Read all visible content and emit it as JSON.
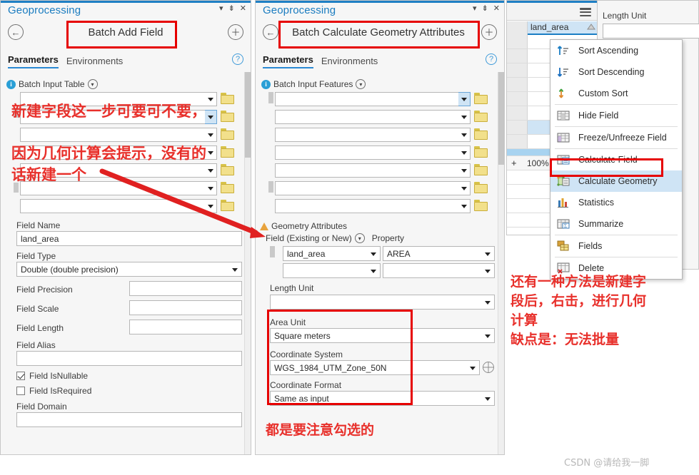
{
  "colors": {
    "accent_blue": "#1f7fc4",
    "title_blue": "#1a7cc0",
    "annotation_red": "#e8302b",
    "highlight_box_red": "#e60000",
    "selection_blue": "#cfe4f5"
  },
  "left_panel": {
    "window_title": "Geoprocessing",
    "tool_name": "Batch Add Field",
    "back_icon": "back-arrow-icon",
    "add_icon": "plus-icon",
    "dropdown_icon": "chevron-down-icon",
    "pin_icon": "pin-icon",
    "close_icon": "close-icon",
    "help_icon": "question-mark-icon",
    "tabs": [
      {
        "label": "Parameters",
        "active": true
      },
      {
        "label": "Environments",
        "active": false
      }
    ],
    "section": {
      "label": "Batch Input Table",
      "info_icon": "info-icon",
      "collapse_icon": "chevron-down-circle-icon"
    },
    "input_rows": [
      {
        "value": "",
        "selected": false
      },
      {
        "value": "",
        "selected": true
      },
      {
        "value": "",
        "selected": false
      },
      {
        "value": "",
        "selected": false
      },
      {
        "value": "",
        "selected": false
      },
      {
        "value": "",
        "selected": false
      },
      {
        "value": "",
        "selected": false
      }
    ],
    "fields": [
      {
        "label": "Field Name",
        "value": "land_area",
        "type": "text",
        "layout": "full"
      },
      {
        "label": "Field Type",
        "value": "Double  (double precision)",
        "type": "select",
        "layout": "full"
      },
      {
        "label": "Field Precision",
        "value": "",
        "type": "text",
        "layout": "split"
      },
      {
        "label": "Field Scale",
        "value": "",
        "type": "text",
        "layout": "split"
      },
      {
        "label": "Field Length",
        "value": "",
        "type": "text",
        "layout": "split"
      },
      {
        "label": "Field Alias",
        "value": "",
        "type": "text",
        "layout": "full"
      }
    ],
    "checkboxes": [
      {
        "label": "Field IsNullable",
        "checked": true
      },
      {
        "label": "Field IsRequired",
        "checked": false
      }
    ],
    "field_domain": {
      "label": "Field Domain",
      "value": ""
    }
  },
  "middle_panel": {
    "window_title": "Geoprocessing",
    "tool_name": "Batch Calculate Geometry Attributes",
    "back_icon": "back-arrow-icon",
    "add_icon": "plus-icon",
    "tabs": [
      {
        "label": "Parameters",
        "active": true
      },
      {
        "label": "Environments",
        "active": false
      }
    ],
    "section": {
      "label": "Batch Input Features",
      "info_icon": "info-icon",
      "collapse_icon": "chevron-down-circle-icon"
    },
    "input_rows": [
      {
        "value": "",
        "selected": true
      },
      {
        "value": "",
        "selected": false
      },
      {
        "value": "",
        "selected": false
      },
      {
        "value": "",
        "selected": false
      },
      {
        "value": "",
        "selected": false
      },
      {
        "value": "",
        "selected": false
      },
      {
        "value": "",
        "selected": false
      }
    ],
    "geometry_attributes": {
      "header": "Geometry Attributes",
      "warning_icon": "warning-triangle-icon",
      "col_field": "Field (Existing or New)",
      "col_property": "Property",
      "collapse_icon": "chevron-down-circle-icon",
      "rows": [
        {
          "field": "land_area",
          "property": "AREA"
        },
        {
          "field": "",
          "property": ""
        }
      ]
    },
    "length_unit": {
      "label": "Length Unit",
      "value": ""
    },
    "area_unit": {
      "label": "Area Unit",
      "value": "Square meters"
    },
    "coordinate_system": {
      "label": "Coordinate System",
      "value": "WGS_1984_UTM_Zone_50N",
      "globe_icon": "globe-icon"
    },
    "coordinate_format": {
      "label": "Coordinate Format",
      "value": "Same as input"
    }
  },
  "table_panel": {
    "menu_icon": "hamburger-menu-icon",
    "column_header": "land_area",
    "sort_indicator_icon": "sort-ascending-indicator-icon",
    "zoom_level": "100%",
    "zoom_in_icon": "plus-icon"
  },
  "context_menu": {
    "items": [
      {
        "label": "Sort Ascending",
        "mnemonic": "A",
        "icon": "sort-ascending-icon",
        "highlighted": false,
        "separator_after": false
      },
      {
        "label": "Sort Descending",
        "mnemonic": "D",
        "icon": "sort-descending-icon",
        "highlighted": false,
        "separator_after": false
      },
      {
        "label": "Custom Sort",
        "mnemonic": "C",
        "icon": "custom-sort-icon",
        "highlighted": false,
        "separator_after": true
      },
      {
        "label": "Hide Field",
        "mnemonic": "",
        "icon": "hide-field-icon",
        "highlighted": false,
        "separator_after": true
      },
      {
        "label": "Freeze/Unfreeze Field",
        "mnemonic": "",
        "icon": "freeze-field-icon",
        "highlighted": false,
        "separator_after": true
      },
      {
        "label": "Calculate Field",
        "mnemonic": "",
        "icon": "calculate-field-icon",
        "highlighted": false,
        "separator_after": false
      },
      {
        "label": "Calculate Geometry",
        "mnemonic": "",
        "icon": "calculate-geometry-icon",
        "highlighted": true,
        "separator_after": false
      },
      {
        "label": "Statistics",
        "mnemonic": "",
        "icon": "statistics-icon",
        "highlighted": false,
        "separator_after": false
      },
      {
        "label": "Summarize",
        "mnemonic": "",
        "icon": "summarize-icon",
        "highlighted": false,
        "separator_after": true
      },
      {
        "label": "Fields",
        "mnemonic": "",
        "icon": "fields-icon",
        "highlighted": false,
        "separator_after": true
      },
      {
        "label": "Delete",
        "mnemonic": "",
        "icon": "delete-icon",
        "highlighted": false,
        "separator_after": false
      }
    ]
  },
  "background_panel": {
    "length_unit_label": "Length Unit",
    "length_unit_value": ""
  },
  "annotations": {
    "left_note_1": "新建字段这一步可要可不要，",
    "left_note_2": "因为几何计算会提示，没有的\n话新建一个",
    "middle_note": "都是要注意勾选的",
    "right_note": "还有一种方法是新建字\n段后，右击，进行几何\n计算\n缺点是：无法批量"
  },
  "watermark": "CSDN @请给我一脚"
}
